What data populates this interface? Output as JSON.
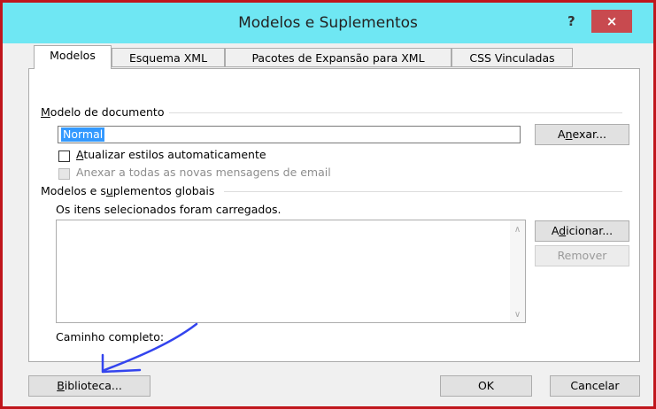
{
  "window": {
    "title": "Modelos e Suplementos",
    "help_glyph": "?",
    "close_glyph": "×"
  },
  "tabs": [
    {
      "label": "Modelos",
      "active": true
    },
    {
      "label": "Esquema XML",
      "active": false
    },
    {
      "label": "Pacotes de Expansão para XML",
      "active": false
    },
    {
      "label": "CSS Vinculadas",
      "active": false
    }
  ],
  "document_template": {
    "group_label_accel": "M",
    "group_label_rest": "odelo de documento",
    "value": "Normal",
    "attach_button_pre": "A",
    "attach_button_accel": "n",
    "attach_button_post": "exar...",
    "auto_update_accel": "A",
    "auto_update_rest": "tualizar estilos automaticamente",
    "auto_update_checked": false,
    "attach_all_label": "Anexar a todas as novas mensagens de email",
    "attach_all_enabled": false
  },
  "global_templates": {
    "group_label_pre": "Modelos e s",
    "group_label_accel": "u",
    "group_label_post": "plementos globais",
    "loaded_note": "Os itens selecionados foram carregados.",
    "items": [],
    "add_button_pre": "A",
    "add_button_accel": "d",
    "add_button_post": "icionar...",
    "remove_button": "Remover",
    "remove_enabled": false,
    "full_path_label": "Caminho completo:"
  },
  "footer": {
    "library_accel": "B",
    "library_rest": "iblioteca...",
    "ok_button": "OK",
    "cancel_button": "Cancelar"
  },
  "colors": {
    "titlebar": "#6fe7f3",
    "close_button": "#c84a4f",
    "frame": "#c0161c",
    "annotation_arrow": "#3344ee",
    "selection": "#3399ff"
  }
}
